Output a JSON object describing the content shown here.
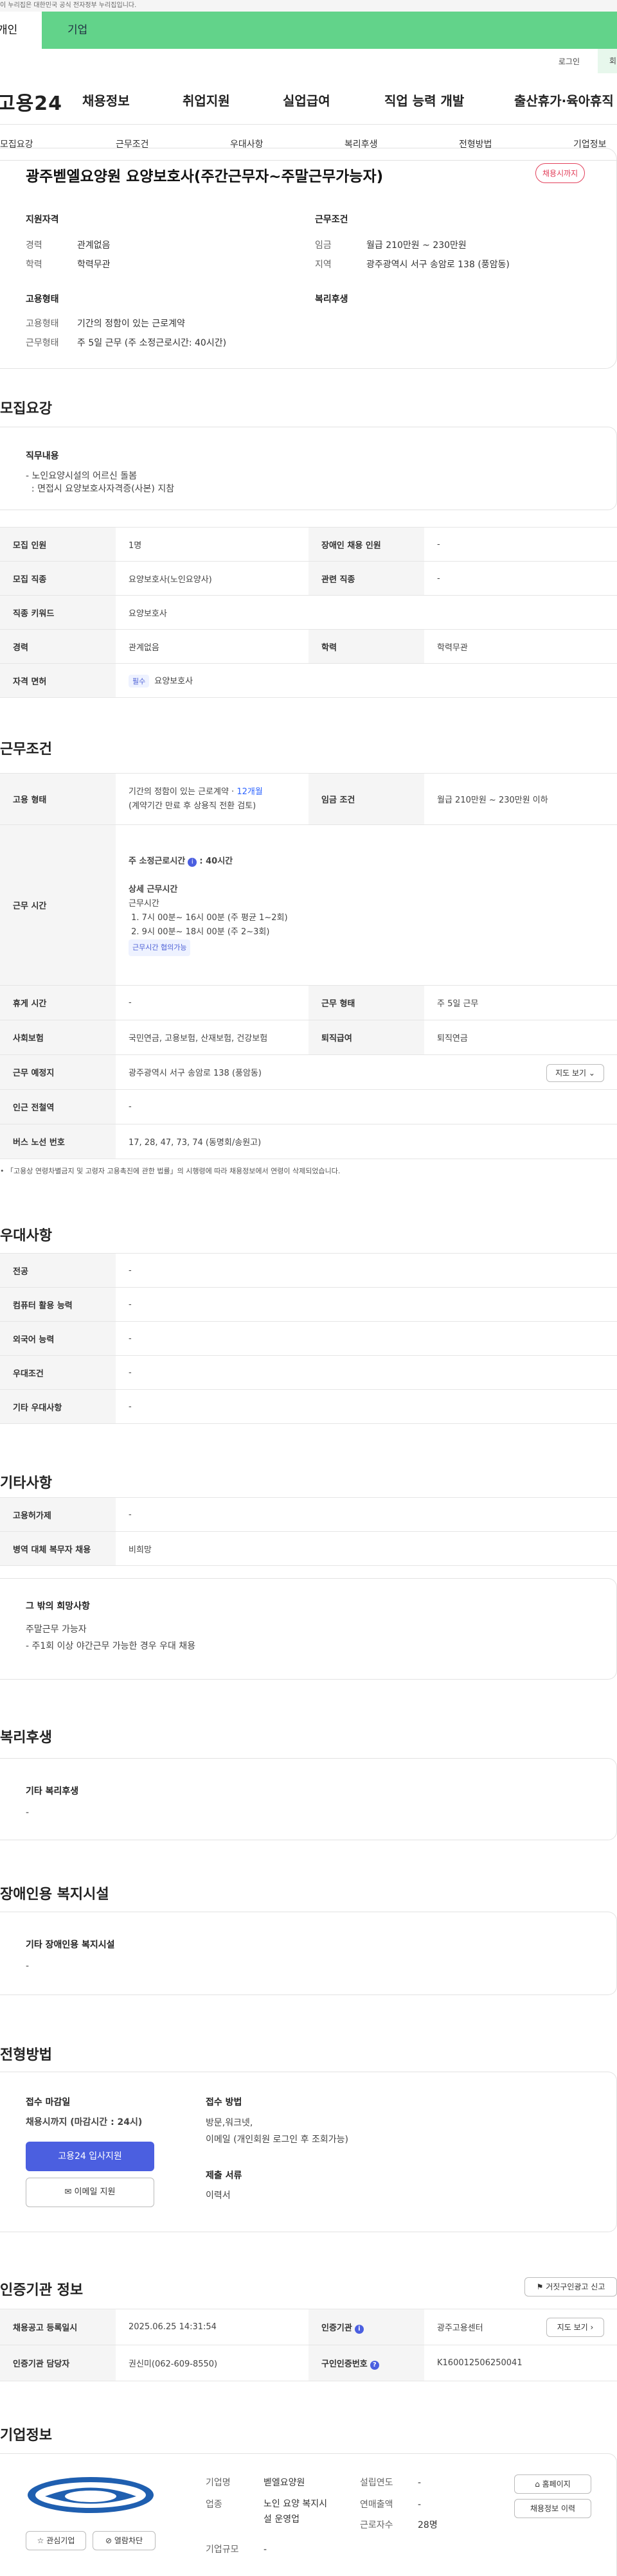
{
  "top_notice": "이 누리집은 대한민국 공식 전자정부 누리집입니다.",
  "category_tabs": [
    "개인",
    "기업"
  ],
  "util_links": [
    "로그인",
    "회원가입"
  ],
  "header": {
    "logo": "고용24",
    "menus": [
      "채용정보",
      "취업지원",
      "실업급여",
      "직업 능력 개발",
      "출산휴가·육아휴직"
    ]
  },
  "subnav": [
    "모집요강",
    "근무조건",
    "우대사항",
    "복리후생",
    "전형방법",
    "기업정보"
  ],
  "job": {
    "title": "광주벧엘요양원 요양보호사(주간근무자~주말근무가능자)",
    "status_badge": "채용시까지",
    "qualification_title": "지원자격",
    "career_label": "경력",
    "career_value": "관계없음",
    "edu_label": "학력",
    "edu_value": "학력무관",
    "work_title": "근무조건",
    "wage_label": "임금",
    "wage_value": "월급 210만원 ~ 230만원",
    "region_label": "지역",
    "region_value": "광주광역시 서구 송암로 138 (풍암동)",
    "employ_title": "고용형태",
    "employ_type_label": "고용형태",
    "employ_type_value": "기간의 정함이 있는 근로계약",
    "work_form_label": "근무형태",
    "work_form_value": "주 5일 근무 (주 소정근로시간: 40시간)",
    "welfare_title": "복리후생"
  },
  "recruit": {
    "section_title": "모집요강",
    "duty_title": "직무내용",
    "duty_text": "- 노인요양시설의 어르신 돌봄\n  : 면접시 요양보호사자격증(사본) 지참",
    "rows": [
      {
        "k1": "모집 인원",
        "v1": "1명",
        "k2": "장애인 채용 인원",
        "v2": "-"
      },
      {
        "k1": "모집 직종",
        "v1": "요양보호사(노인요양사)",
        "k2": "관련 직종",
        "v2": "-"
      },
      {
        "k1": "직종 키워드",
        "v1": "요양보호사",
        "k2": "",
        "v2": ""
      },
      {
        "k1": "경력",
        "v1": "관계없음",
        "k2": "학력",
        "v2": "학력무관"
      }
    ],
    "license_label": "자격 면허",
    "license_chip": "필수",
    "license_value": "요양보호사"
  },
  "conditions": {
    "section_title": "근무조건",
    "employ_label": "고용 형태",
    "employ_value": "기간의 정함이 있는 근로계약 · ",
    "employ_months": "12개월",
    "employ_note": "(계약기간 만료 후 상용직 전환 검토)",
    "wage_label": "임금 조건",
    "wage_value": "월급 210만원 ~ 230만원 이하",
    "hours_label": "근무 시간",
    "weekly_hours": "주 소정근로시간",
    "weekly_hours_value": ": 40시간",
    "detail_title": "상세 근무시간",
    "detail_sub": "근무시간",
    "shifts": [
      "1. 7시 00분~ 16시 00분 (주 평균 1~2회)",
      "2. 9시 00분~ 18시 00분 (주 2~3회)"
    ],
    "shift_chip": "근무시간 협의가능",
    "rows": [
      {
        "k1": "휴게 시간",
        "v1": "-",
        "k2": "근무 형태",
        "v2": "주 5일 근무"
      },
      {
        "k1": "사회보험",
        "v1": "국민연금, 고용보험, 산재보험, 건강보험",
        "k2": "퇴직급여",
        "v2": "퇴직연금"
      }
    ],
    "place_label": "근무 예정지",
    "place_value": "광주광역시 서구 송암로 138 (풍암동)",
    "map_button": "지도 보기",
    "station_label": "인근 전철역",
    "station_value": "-",
    "bus_label": "버스 노선 번호",
    "bus_value": "17, 28, 47, 73, 74 (동명회/송원고)",
    "footnote": "「고용상 연령차별금지 및 고령자 고용촉진에 관한 법률」의 시행령에 따라 채용정보에서 연령이 삭제되었습니다."
  },
  "preference": {
    "section_title": "우대사항",
    "rows": [
      {
        "k": "전공",
        "v": "-"
      },
      {
        "k": "컴퓨터 활용 능력",
        "v": "-"
      },
      {
        "k": "외국어 능력",
        "v": "-"
      },
      {
        "k": "우대조건",
        "v": "-"
      },
      {
        "k": "기타 우대사항",
        "v": "-"
      }
    ]
  },
  "etc": {
    "section_title": "기타사항",
    "rows": [
      {
        "k": "고용허가제",
        "v": "-"
      },
      {
        "k": "병역 대체 복무자 채용",
        "v": "비희망"
      }
    ],
    "other_title": "그 밖의 희망사항",
    "other_text": "주말근무 가능자\n- 주1회 이상 야간근무 가능한 경우 우대 채용"
  },
  "welfare": {
    "section_title": "복리후생",
    "box_title": "기타 복리후생",
    "box_text": "-"
  },
  "disability": {
    "section_title": "장애인용 복지시설",
    "box_title": "기타 장애인용 복지시설",
    "box_text": "-"
  },
  "selection": {
    "section_title": "전형방법",
    "deadline_title": "접수 마감일",
    "deadline_value": "채용시까지 (마감시간 : 24시)",
    "apply_button": "고용24 입사지원",
    "email_button": "이메일 지원",
    "method_title": "접수 방법",
    "method_text": "방문,워크넷,\n이메일 (개인회원 로그인 후 조회가능)",
    "docs_title": "제출 서류",
    "docs_text": "이력서"
  },
  "agency": {
    "section_title": "인증기관 정보",
    "report_button": "거짓구인광고 신고",
    "reg_label": "채용공고 등록일시",
    "reg_value": "2025.06.25 14:31:54",
    "org_label": "인증기관",
    "org_value": "광주고용센터",
    "map_button": "지도 보기",
    "manager_label": "인증기관 담당자",
    "manager_value": "권신미(062-609-8550)",
    "id_label": "구인인증번호",
    "id_value": "K160012506250041"
  },
  "company": {
    "section_title": "기업정보",
    "name_label": "기업명",
    "name_value": "벧엘요양원",
    "industry_label": "업종",
    "industry_value": "노인 요양 복지시\n설 운영업",
    "size_label": "기업규모",
    "size_value": "-",
    "founded_label": "설립연도",
    "founded_value": "-",
    "revenue_label": "연매출액",
    "revenue_value": "-",
    "staff_label": "근로자수",
    "staff_value": "28명",
    "fav_button": "관심기업",
    "block_button": "열람차단",
    "home_button": "홈페이지",
    "history_button": "채용정보 이력"
  }
}
